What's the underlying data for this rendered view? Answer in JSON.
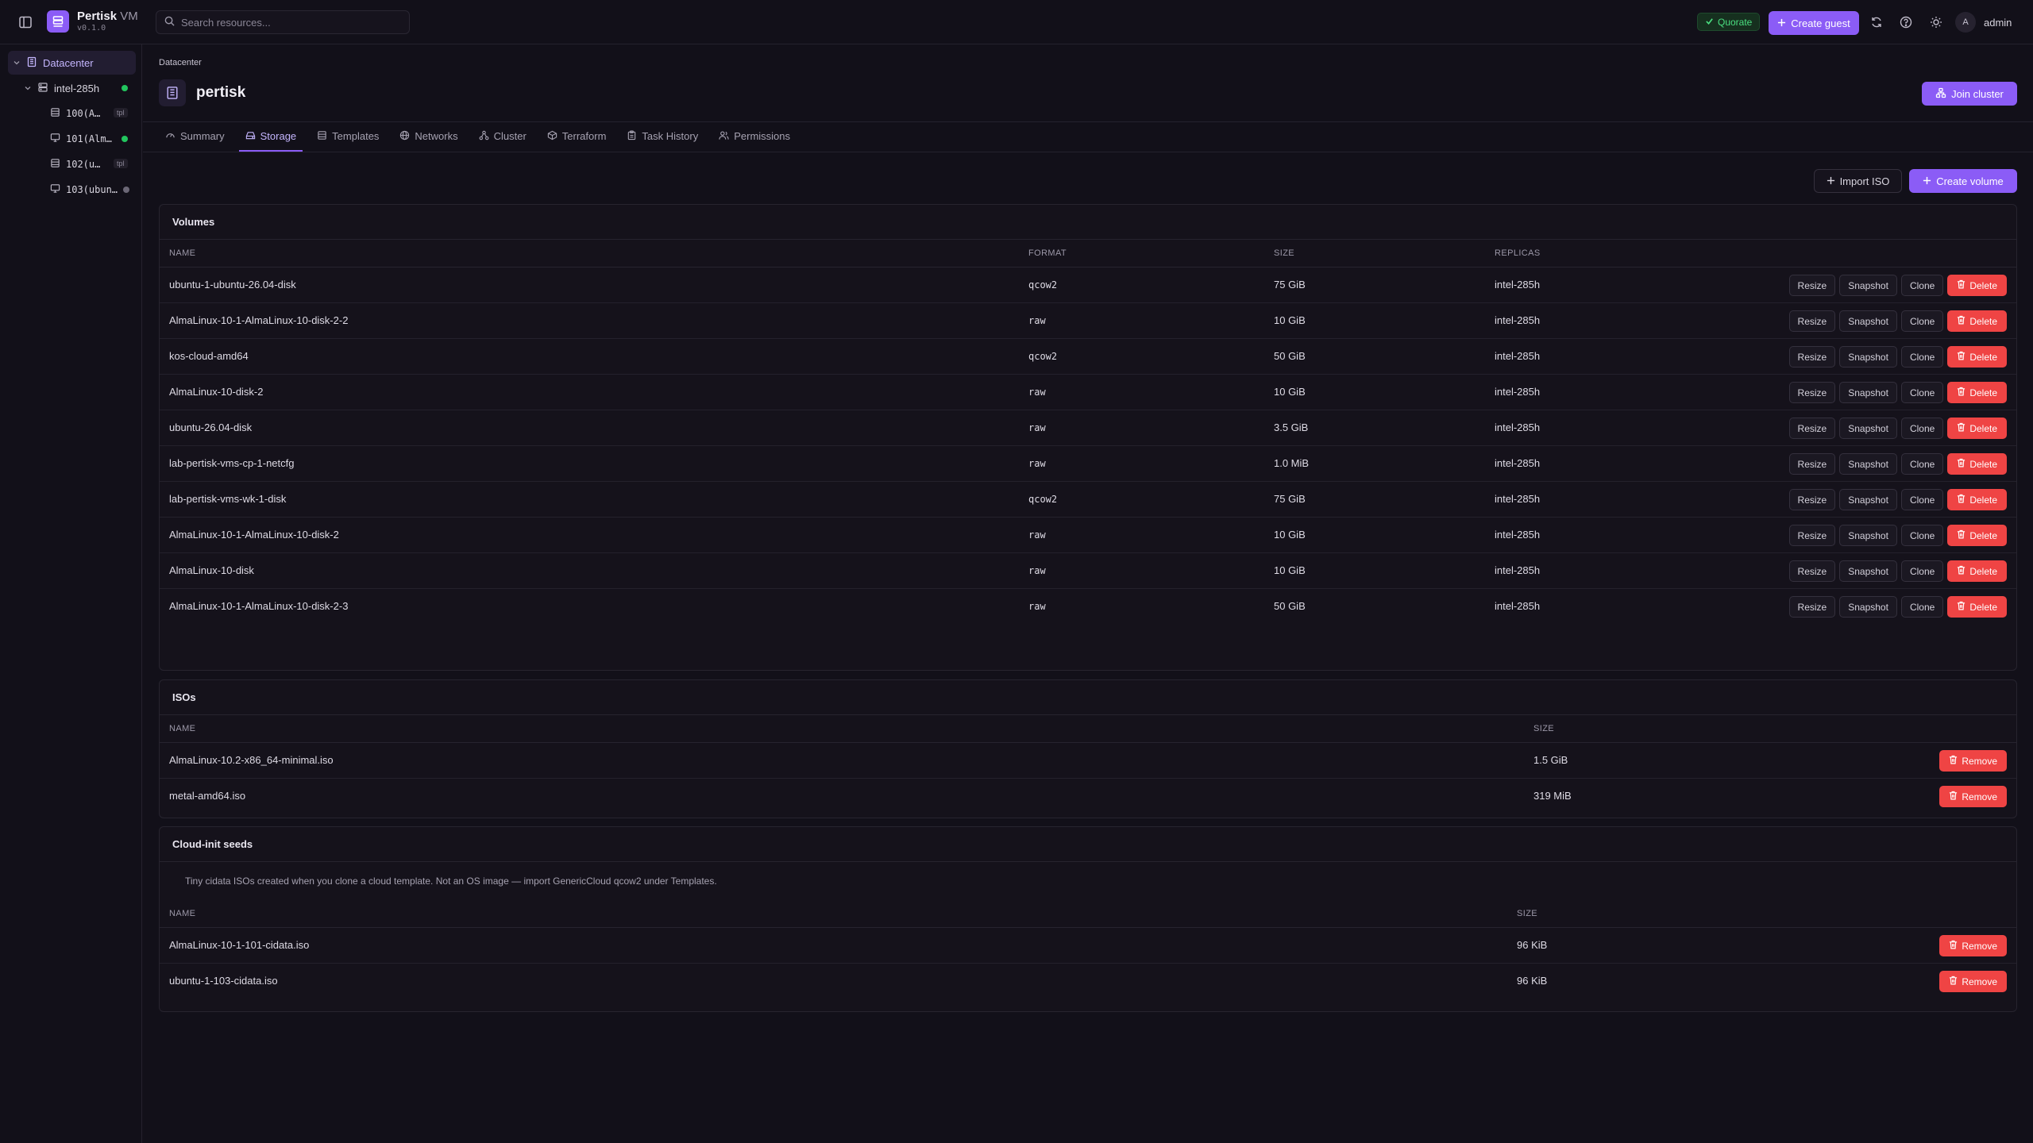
{
  "app": {
    "name": "Pertisk",
    "name_suffix": "VM",
    "version": "v0.1.0"
  },
  "search": {
    "placeholder": "Search resources..."
  },
  "topbar": {
    "quorate_label": "Quorate",
    "create_guest_label": "Create guest",
    "user_initial": "A",
    "user_name": "admin"
  },
  "sidebar": {
    "datacenter_label": "Datacenter",
    "node": {
      "label": "intel-285h",
      "status_color": "#22c55e"
    },
    "guests": [
      {
        "label": "100(A…",
        "badge": "tpl",
        "type": "template"
      },
      {
        "label": "101(Alm…",
        "status_color": "#22c55e",
        "type": "vm"
      },
      {
        "label": "102(u…",
        "badge": "tpl",
        "type": "template"
      },
      {
        "label": "103(ubun…",
        "status_color": "#6b6776",
        "type": "vm"
      }
    ]
  },
  "page": {
    "breadcrumb": "Datacenter",
    "title": "pertisk",
    "join_cluster_label": "Join cluster",
    "tabs": [
      "Summary",
      "Storage",
      "Templates",
      "Networks",
      "Cluster",
      "Terraform",
      "Task History",
      "Permissions"
    ],
    "active_tab": "Storage"
  },
  "toolbar": {
    "import_iso_label": "Import ISO",
    "create_volume_label": "Create volume"
  },
  "volumes": {
    "title": "Volumes",
    "columns": [
      "NAME",
      "FORMAT",
      "SIZE",
      "REPLICAS"
    ],
    "action_labels": {
      "resize": "Resize",
      "snapshot": "Snapshot",
      "clone": "Clone",
      "delete": "Delete"
    },
    "rows": [
      {
        "name": "ubuntu-1-ubuntu-26.04-disk",
        "format": "qcow2",
        "size": "75 GiB",
        "replicas": "intel-285h"
      },
      {
        "name": "AlmaLinux-10-1-AlmaLinux-10-disk-2-2",
        "format": "raw",
        "size": "10 GiB",
        "replicas": "intel-285h"
      },
      {
        "name": "kos-cloud-amd64",
        "format": "qcow2",
        "size": "50 GiB",
        "replicas": "intel-285h"
      },
      {
        "name": "AlmaLinux-10-disk-2",
        "format": "raw",
        "size": "10 GiB",
        "replicas": "intel-285h"
      },
      {
        "name": "ubuntu-26.04-disk",
        "format": "raw",
        "size": "3.5 GiB",
        "replicas": "intel-285h"
      },
      {
        "name": "lab-pertisk-vms-cp-1-netcfg",
        "format": "raw",
        "size": "1.0 MiB",
        "replicas": "intel-285h"
      },
      {
        "name": "lab-pertisk-vms-wk-1-disk",
        "format": "qcow2",
        "size": "75 GiB",
        "replicas": "intel-285h"
      },
      {
        "name": "AlmaLinux-10-1-AlmaLinux-10-disk-2",
        "format": "raw",
        "size": "10 GiB",
        "replicas": "intel-285h"
      },
      {
        "name": "AlmaLinux-10-disk",
        "format": "raw",
        "size": "10 GiB",
        "replicas": "intel-285h"
      },
      {
        "name": "AlmaLinux-10-1-AlmaLinux-10-disk-2-3",
        "format": "raw",
        "size": "50 GiB",
        "replicas": "intel-285h"
      }
    ]
  },
  "isos": {
    "title": "ISOs",
    "columns": [
      "NAME",
      "SIZE"
    ],
    "remove_label": "Remove",
    "rows": [
      {
        "name": "AlmaLinux-10.2-x86_64-minimal.iso",
        "size": "1.5 GiB"
      },
      {
        "name": "metal-amd64.iso",
        "size": "319 MiB"
      }
    ]
  },
  "seeds": {
    "title": "Cloud-init seeds",
    "description": "Tiny cidata ISOs created when you clone a cloud template. Not an OS image — import GenericCloud qcow2 under Templates.",
    "columns": [
      "NAME",
      "SIZE"
    ],
    "remove_label": "Remove",
    "rows": [
      {
        "name": "AlmaLinux-10-1-101-cidata.iso",
        "size": "96 KiB"
      },
      {
        "name": "ubuntu-1-103-cidata.iso",
        "size": "96 KiB"
      }
    ]
  },
  "colors": {
    "accent": "#8b5cf6",
    "danger": "#ef4444",
    "success": "#22c55e",
    "background": "#121019"
  }
}
